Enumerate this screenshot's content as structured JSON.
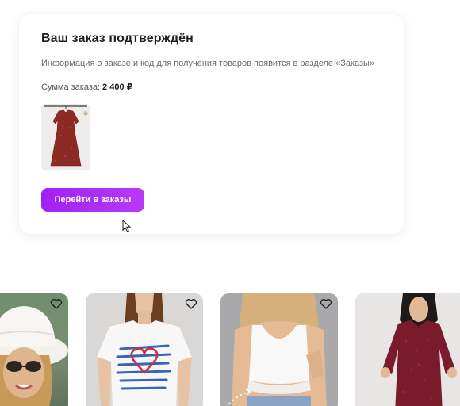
{
  "order": {
    "title": "Ваш заказ подтверждён",
    "info": "Информация о заказе и код для получения товаров появится в разделе «Заказы»",
    "sum_label": "Сумма заказа:",
    "sum_value": "2 400 ₽",
    "button_label": "Перейти в заказы"
  },
  "colors": {
    "accent": "#a623f3",
    "text_primary": "#1f1f1f",
    "text_secondary": "#6b6b76"
  },
  "products": [
    {
      "name": "woman-in-white-hat",
      "favorite_icon": "heart-outline-icon"
    },
    {
      "name": "white-tshirt-heart-print",
      "favorite_icon": "heart-outline-icon"
    },
    {
      "name": "white-tank-top",
      "favorite_icon": "heart-outline-icon"
    },
    {
      "name": "burgundy-dress",
      "favorite_icon": "heart-outline-icon"
    }
  ]
}
